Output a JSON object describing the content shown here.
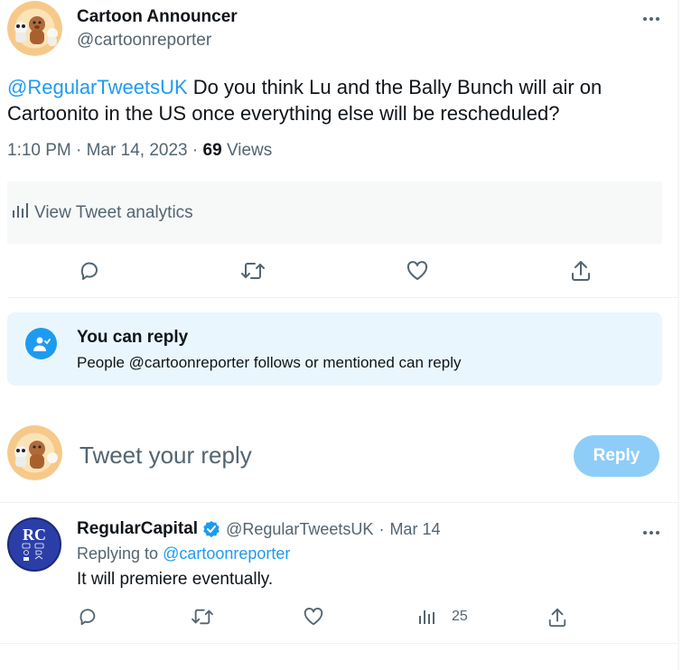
{
  "tweet": {
    "author_name": "Cartoon Announcer",
    "author_handle": "@cartoonreporter",
    "more_icon": "more-dots",
    "mention": "@RegularTweetsUK",
    "text": " Do you think Lu and the Bally Bunch will air on Cartoonito in the US once everything else will be rescheduled?",
    "time": "1:10 PM",
    "sep1": "·",
    "date": "Mar 14, 2023",
    "sep2": "·",
    "views_count": "69",
    "views_label": "Views"
  },
  "analytics": {
    "label": "View Tweet analytics",
    "icon": "chart-bars"
  },
  "actions": {
    "icons": [
      "reply-bubble",
      "retweet-arrows",
      "like-heart",
      "share-upload"
    ]
  },
  "reply_permission": {
    "title": "You can reply",
    "description": "People @cartoonreporter follows or mentioned can reply",
    "icon": "person-check"
  },
  "compose": {
    "placeholder": "Tweet your reply",
    "button_label": "Reply",
    "button_color": "#8ecdf8"
  },
  "reply": {
    "author_name": "RegularCapital",
    "verified_icon": "verified-badge",
    "author_handle": "@RegularTweetsUK",
    "sep": "·",
    "date": "Mar 14",
    "replying_prefix": "Replying to",
    "replying_to": "@cartoonreporter",
    "text": "It will premiere eventually.",
    "avatar_letters": "RC",
    "views_count": "25"
  },
  "colors": {
    "accent": "#1d9bf0",
    "muted": "#536471",
    "text": "#0f1419"
  }
}
